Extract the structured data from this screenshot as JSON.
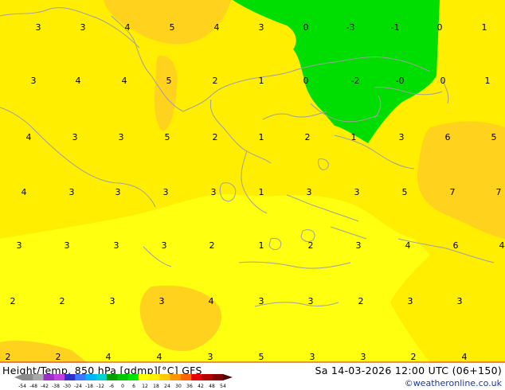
{
  "title": "Height/Temp. 850 hPa [gdmp][°C] GFS",
  "datetime": "Sa 14-03-2026 12:00 UTC (06+150)",
  "credit": "©weatheronline.co.uk",
  "colorbar": {
    "ticks": [
      "-54",
      "-48",
      "-42",
      "-38",
      "-30",
      "-24",
      "-18",
      "-12",
      "-6",
      "0",
      "6",
      "12",
      "18",
      "24",
      "30",
      "36",
      "42",
      "48",
      "54"
    ],
    "colors": [
      "#8c8c8c",
      "#a8a8a8",
      "#9b30c8",
      "#c040e0",
      "#3030c8",
      "#3c78ff",
      "#00b4ff",
      "#00d2d2",
      "#00a000",
      "#00c800",
      "#00e600",
      "#ffff00",
      "#fff000",
      "#ffc800",
      "#ff9600",
      "#ff6400",
      "#e60000",
      "#b40000",
      "#820000"
    ]
  },
  "colors": {
    "yellow": "#ffee00",
    "yellow_light": "#ffff10",
    "orange_light": "#ffd21e",
    "green": "#00dd00",
    "coastline": "#a0a0a0"
  },
  "temperature_labels": [
    [
      "3",
      "3",
      "4",
      "5",
      "4",
      "3",
      "0",
      "-3",
      "-1",
      "0",
      "1"
    ],
    [
      "3",
      "4",
      "4",
      "5",
      "2",
      "1",
      "0",
      "-2",
      "-0",
      "0",
      "1"
    ],
    [
      "4",
      "3",
      "3",
      "5",
      "2",
      "1",
      "2",
      "1",
      "3",
      "6",
      "5"
    ],
    [
      "4",
      "3",
      "3",
      "3",
      "3",
      "1",
      "3",
      "3",
      "5",
      "7",
      "7"
    ],
    [
      "3",
      "3",
      "3",
      "3",
      "2",
      "1",
      "2",
      "3",
      "4",
      "6",
      "4"
    ],
    [
      "2",
      "2",
      "3",
      "3",
      "4",
      "3",
      "3",
      "2",
      "3",
      "3"
    ],
    [
      "2",
      "2",
      "4",
      "4",
      "3",
      "5",
      "3",
      "3",
      "2",
      "4"
    ]
  ]
}
